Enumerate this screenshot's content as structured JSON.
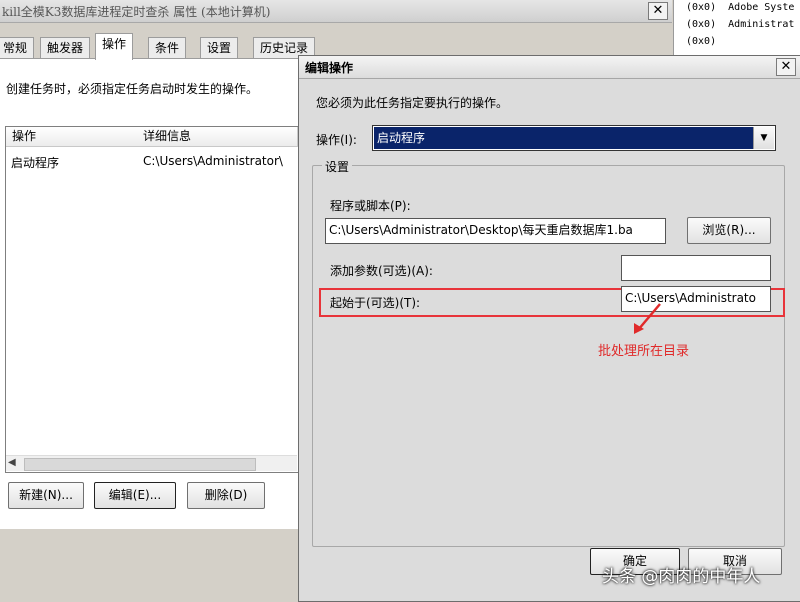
{
  "background_window": {
    "title": "kill全模K3数据库进程定时查杀 属性 (本地计算机)",
    "close": "✕",
    "tabs": [
      "常规",
      "触发器",
      "操作",
      "条件",
      "设置",
      "历史记录"
    ],
    "active_tab": "操作",
    "description": "创建任务时，必须指定任务启动时发生的操作。",
    "list": {
      "columns": [
        "操作",
        "详细信息"
      ],
      "rows": [
        {
          "action": "启动程序",
          "detail": "C:\\Users\\Administrator\\"
        }
      ],
      "scroll_left_arrow": "◀"
    },
    "buttons": {
      "new": "新建(N)...",
      "edit": "编辑(E)...",
      "delete": "删除(D)"
    }
  },
  "side_panel": {
    "rows": [
      {
        "code": "(0x0)",
        "name": "Adobe Syste"
      },
      {
        "code": "(0x0)",
        "name": "Administrat"
      },
      {
        "code": "(0x0)",
        "name": ""
      }
    ]
  },
  "dialog": {
    "title": "编辑操作",
    "close": "✕",
    "description": "您必须为此任务指定要执行的操作。",
    "action_label": "操作(I):",
    "action_value": "启动程序",
    "dropdown_arrow": "▼",
    "settings_legend": "设置",
    "program_label": "程序或脚本(P):",
    "program_value": "C:\\Users\\Administrator\\Desktop\\每天重启数据库1.ba",
    "browse_button": "浏览(R)...",
    "args_label": "添加参数(可选)(A):",
    "args_value": "",
    "start_in_label": "起始于(可选)(T):",
    "start_in_value": "C:\\Users\\Administrato",
    "ok_button": "确定",
    "cancel_button": "取消"
  },
  "annotation": {
    "text": "批处理所在目录",
    "color": "#e02a2a"
  },
  "watermark": "头条 @肉肉的中年人"
}
